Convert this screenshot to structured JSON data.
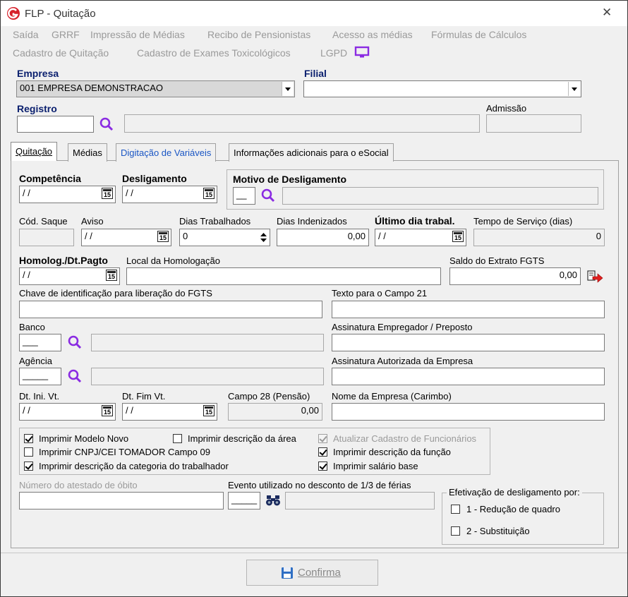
{
  "window": {
    "title": "FLP - Quitação",
    "close": "✕"
  },
  "menu": {
    "row1": [
      "Saída",
      "GRRF",
      "Impressão de Médias",
      "Recibo de Pensionistas",
      "Acesso as médias",
      "Fórmulas de Cálculos"
    ],
    "row2": [
      "Cadastro de Quitação",
      "Cadastro de Exames Toxicológicos",
      "LGPD"
    ]
  },
  "header": {
    "empresa_label": "Empresa",
    "empresa_value": "001 EMPRESA DEMONSTRACAO",
    "filial_label": "Filial",
    "filial_value": "",
    "registro_label": "Registro",
    "registro_value": "",
    "registro_name": "",
    "admissao_label": "Admissão",
    "admissao_value": ""
  },
  "tabs": [
    "Quitação",
    "Médias",
    "Digitação de Variáveis",
    "Informações adicionais para o eSocial"
  ],
  "form": {
    "competencia_label": "Competência",
    "competencia_value": " / /",
    "desligamento_label": "Desligamento",
    "desligamento_value": " / /",
    "motivo_label": "Motivo de Desligamento",
    "motivo_code": "__",
    "cod_saque_label": "Cód. Saque",
    "aviso_label": "Aviso",
    "aviso_value": " / /",
    "dias_trab_label": "Dias Trabalhados",
    "dias_trab_value": "0",
    "dias_indeniz_label": "Dias Indenizados",
    "dias_indeniz_value": "0,00",
    "ultimo_dia_label": "Último dia trabal.",
    "ultimo_dia_value": " / /",
    "tempo_serv_label": "Tempo de Serviço (dias)",
    "tempo_serv_value": "0",
    "homolog_label": "Homolog./Dt.Pagto",
    "homolog_value": " / /",
    "local_homolog_label": "Local da Homologação",
    "saldo_fgts_label": "Saldo do Extrato FGTS",
    "saldo_fgts_value": "0,00",
    "chave_fgts_label": "Chave de identificação para liberação do FGTS",
    "texto21_label": "Texto para o Campo 21",
    "banco_label": "Banco",
    "banco_value": "___",
    "assin_emp_label": "Assinatura Empregador / Preposto",
    "agencia_label": "Agência",
    "agencia_value": "_____",
    "assin_aut_label": "Assinatura Autorizada da Empresa",
    "dt_ini_vt_label": "Dt. Ini. Vt.",
    "dt_ini_vt_value": " / /",
    "dt_fim_vt_label": "Dt. Fim Vt.",
    "dt_fim_vt_value": " / /",
    "campo28_label": "Campo 28 (Pensão)",
    "campo28_value": "0,00",
    "nome_empresa_label": "Nome da Empresa (Carimbo)",
    "cal_day": "15"
  },
  "checkboxes": {
    "modelo_novo": {
      "label": "Imprimir Modelo Novo",
      "checked": true
    },
    "descricao_area": {
      "label": "Imprimir descrição da área",
      "checked": false
    },
    "atualizar_cadastro": {
      "label": "Atualizar Cadastro de Funcionários",
      "checked": true
    },
    "cnpj_tomador": {
      "label": "Imprimir CNPJ/CEI TOMADOR Campo 09",
      "checked": false
    },
    "descricao_funcao": {
      "label": "Imprimir descrição da função",
      "checked": true
    },
    "descricao_categoria": {
      "label": "Imprimir descrição da categoria do trabalhador",
      "checked": true
    },
    "salario_base": {
      "label": "Imprimir salário base",
      "checked": true
    }
  },
  "bottom": {
    "atestado_label": "Número do atestado de óbito",
    "evento_label": "Evento utilizado no desconto de 1/3 de férias",
    "evento_code": "_____",
    "efetivacao_label": "Efetivação de desligamento por:",
    "opt1": "1 - Redução de quadro",
    "opt2": "2 - Substituição",
    "confirma_label": "Confirma"
  },
  "colors": {
    "logo": "#d6202a",
    "accent_purple": "#8a2be2",
    "link_blue": "#1a56c4",
    "label_navy": "#0a1f6e"
  },
  "icons": [
    "logo-g-icon",
    "close-icon",
    "monitor-icon",
    "magnifier-icon",
    "calendar-icon",
    "spin-arrows-icon",
    "export-arrow-icon",
    "binoculars-icon",
    "save-disk-icon"
  ]
}
